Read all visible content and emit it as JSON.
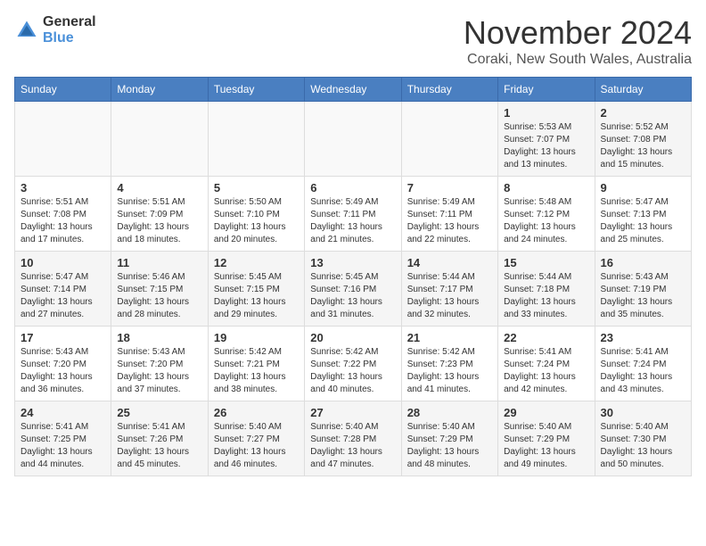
{
  "header": {
    "logo_general": "General",
    "logo_blue": "Blue",
    "month_title": "November 2024",
    "location": "Coraki, New South Wales, Australia"
  },
  "calendar": {
    "days_of_week": [
      "Sunday",
      "Monday",
      "Tuesday",
      "Wednesday",
      "Thursday",
      "Friday",
      "Saturday"
    ],
    "weeks": [
      [
        {
          "day": "",
          "info": ""
        },
        {
          "day": "",
          "info": ""
        },
        {
          "day": "",
          "info": ""
        },
        {
          "day": "",
          "info": ""
        },
        {
          "day": "",
          "info": ""
        },
        {
          "day": "1",
          "info": "Sunrise: 5:53 AM\nSunset: 7:07 PM\nDaylight: 13 hours and 13 minutes."
        },
        {
          "day": "2",
          "info": "Sunrise: 5:52 AM\nSunset: 7:08 PM\nDaylight: 13 hours and 15 minutes."
        }
      ],
      [
        {
          "day": "3",
          "info": "Sunrise: 5:51 AM\nSunset: 7:08 PM\nDaylight: 13 hours and 17 minutes."
        },
        {
          "day": "4",
          "info": "Sunrise: 5:51 AM\nSunset: 7:09 PM\nDaylight: 13 hours and 18 minutes."
        },
        {
          "day": "5",
          "info": "Sunrise: 5:50 AM\nSunset: 7:10 PM\nDaylight: 13 hours and 20 minutes."
        },
        {
          "day": "6",
          "info": "Sunrise: 5:49 AM\nSunset: 7:11 PM\nDaylight: 13 hours and 21 minutes."
        },
        {
          "day": "7",
          "info": "Sunrise: 5:49 AM\nSunset: 7:11 PM\nDaylight: 13 hours and 22 minutes."
        },
        {
          "day": "8",
          "info": "Sunrise: 5:48 AM\nSunset: 7:12 PM\nDaylight: 13 hours and 24 minutes."
        },
        {
          "day": "9",
          "info": "Sunrise: 5:47 AM\nSunset: 7:13 PM\nDaylight: 13 hours and 25 minutes."
        }
      ],
      [
        {
          "day": "10",
          "info": "Sunrise: 5:47 AM\nSunset: 7:14 PM\nDaylight: 13 hours and 27 minutes."
        },
        {
          "day": "11",
          "info": "Sunrise: 5:46 AM\nSunset: 7:15 PM\nDaylight: 13 hours and 28 minutes."
        },
        {
          "day": "12",
          "info": "Sunrise: 5:45 AM\nSunset: 7:15 PM\nDaylight: 13 hours and 29 minutes."
        },
        {
          "day": "13",
          "info": "Sunrise: 5:45 AM\nSunset: 7:16 PM\nDaylight: 13 hours and 31 minutes."
        },
        {
          "day": "14",
          "info": "Sunrise: 5:44 AM\nSunset: 7:17 PM\nDaylight: 13 hours and 32 minutes."
        },
        {
          "day": "15",
          "info": "Sunrise: 5:44 AM\nSunset: 7:18 PM\nDaylight: 13 hours and 33 minutes."
        },
        {
          "day": "16",
          "info": "Sunrise: 5:43 AM\nSunset: 7:19 PM\nDaylight: 13 hours and 35 minutes."
        }
      ],
      [
        {
          "day": "17",
          "info": "Sunrise: 5:43 AM\nSunset: 7:20 PM\nDaylight: 13 hours and 36 minutes."
        },
        {
          "day": "18",
          "info": "Sunrise: 5:43 AM\nSunset: 7:20 PM\nDaylight: 13 hours and 37 minutes."
        },
        {
          "day": "19",
          "info": "Sunrise: 5:42 AM\nSunset: 7:21 PM\nDaylight: 13 hours and 38 minutes."
        },
        {
          "day": "20",
          "info": "Sunrise: 5:42 AM\nSunset: 7:22 PM\nDaylight: 13 hours and 40 minutes."
        },
        {
          "day": "21",
          "info": "Sunrise: 5:42 AM\nSunset: 7:23 PM\nDaylight: 13 hours and 41 minutes."
        },
        {
          "day": "22",
          "info": "Sunrise: 5:41 AM\nSunset: 7:24 PM\nDaylight: 13 hours and 42 minutes."
        },
        {
          "day": "23",
          "info": "Sunrise: 5:41 AM\nSunset: 7:24 PM\nDaylight: 13 hours and 43 minutes."
        }
      ],
      [
        {
          "day": "24",
          "info": "Sunrise: 5:41 AM\nSunset: 7:25 PM\nDaylight: 13 hours and 44 minutes."
        },
        {
          "day": "25",
          "info": "Sunrise: 5:41 AM\nSunset: 7:26 PM\nDaylight: 13 hours and 45 minutes."
        },
        {
          "day": "26",
          "info": "Sunrise: 5:40 AM\nSunset: 7:27 PM\nDaylight: 13 hours and 46 minutes."
        },
        {
          "day": "27",
          "info": "Sunrise: 5:40 AM\nSunset: 7:28 PM\nDaylight: 13 hours and 47 minutes."
        },
        {
          "day": "28",
          "info": "Sunrise: 5:40 AM\nSunset: 7:29 PM\nDaylight: 13 hours and 48 minutes."
        },
        {
          "day": "29",
          "info": "Sunrise: 5:40 AM\nSunset: 7:29 PM\nDaylight: 13 hours and 49 minutes."
        },
        {
          "day": "30",
          "info": "Sunrise: 5:40 AM\nSunset: 7:30 PM\nDaylight: 13 hours and 50 minutes."
        }
      ]
    ]
  }
}
